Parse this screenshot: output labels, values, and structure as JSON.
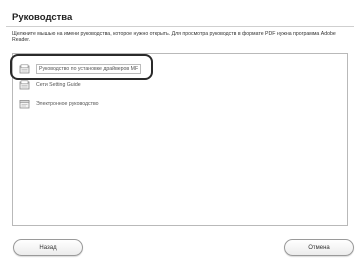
{
  "dialog": {
    "title": "Руководства",
    "description": "Щелкните мышью на имени руководства, которое нужно открыть. Для просмотра руководств в формате PDF нужна программа Adobe Reader."
  },
  "manuals": [
    {
      "label": "Руководство по установке драйверов MF",
      "icon": "pdf-document-icon",
      "selected": true
    },
    {
      "label": "Сети Setting Guide",
      "icon": "pdf-document-icon",
      "selected": false
    },
    {
      "label": "Электронное руководство",
      "icon": "html-document-icon",
      "selected": false
    }
  ],
  "buttons": {
    "back": "Назад",
    "cancel": "Отмена"
  },
  "colors": {
    "highlight_ring": "#2a2a2a",
    "list_border": "#b9b9b9"
  }
}
